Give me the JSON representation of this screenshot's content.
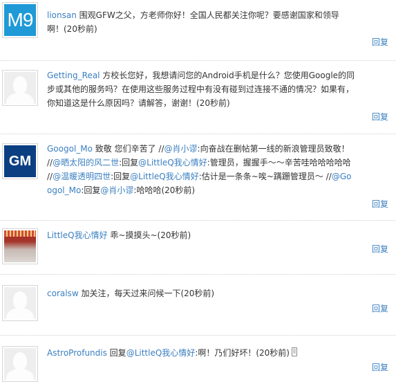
{
  "reply_label": "回复",
  "comments": [
    {
      "user": "lionsan",
      "avatar_text": "M9",
      "text": " 围观GFW之父，方老师你好！全国人民都关注你呢？要感谢国家和领导啊！(20秒前)"
    },
    {
      "user": "Getting_Real",
      "text": " 方校长您好，我想请问您的Android手机是什么？您使用Google的同步或其他的服务吗？在使用这些服务过程中有没有碰到过连接不通的情况？如果有，你知道这是什么原因吗？请解答，谢谢！(20秒前)"
    },
    {
      "user": "Googol_Mo",
      "avatar_text": "GM",
      "parts": [
        {
          "t": " 致敬  您们辛苦了  //"
        },
        {
          "m": "@肖小谬"
        },
        {
          "t": ":向奋战在删帖第一线的新浪管理员致敬！  //"
        },
        {
          "m": "@晒太阳的风二世"
        },
        {
          "t": ":回复"
        },
        {
          "m": "@LittleQ我心情好"
        },
        {
          "t": ":管理员，握握手～～辛苦哇哈哈哈哈哈 //"
        },
        {
          "m": "@温暖透明四世"
        },
        {
          "t": ":回复"
        },
        {
          "m": "@LittleQ我心情好"
        },
        {
          "t": ":估计是一条条~唉~蹒跚管理员～ //"
        },
        {
          "m": "@Googol_Mo"
        },
        {
          "t": ":回复"
        },
        {
          "m": "@肖小谬"
        },
        {
          "t": ":哈哈哈(20秒前)"
        }
      ]
    },
    {
      "user": "LittleQ我心情好",
      "text": "  乖~摸摸头~(20秒前)"
    },
    {
      "user": "coralsw",
      "text": " 加关注，每天过来问候一下(20秒前)"
    },
    {
      "user": "AstroProfundis",
      "parts": [
        {
          "t": " 回复"
        },
        {
          "m": "@LittleQ我心情好"
        },
        {
          "t": ":啊！乃们好坏！(20秒前)"
        }
      ],
      "device_icon": "mobile-phone-icon"
    }
  ]
}
